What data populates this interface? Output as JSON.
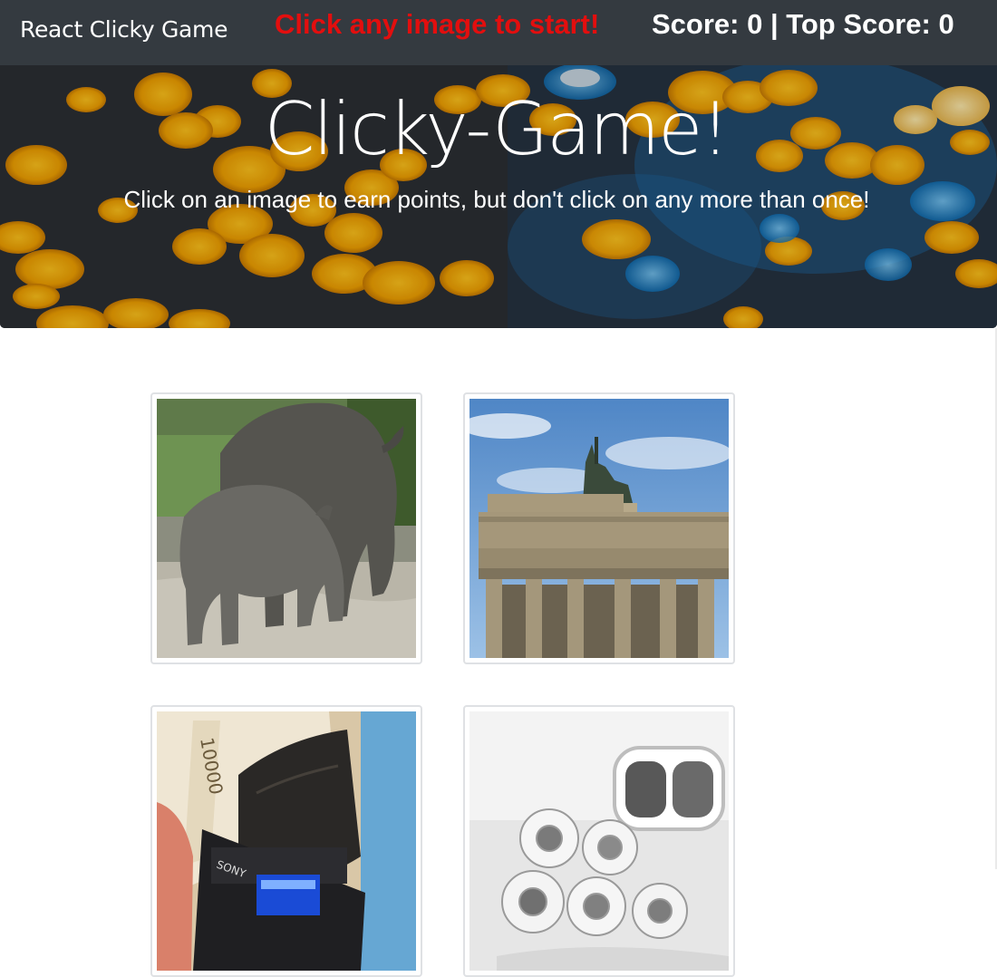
{
  "navbar": {
    "brand": "React Clicky Game",
    "status_message": "Click any image to start!",
    "status_color": "#e30e0e",
    "score_text": "Score: 0 | Top Score: 0"
  },
  "jumbotron": {
    "title": "Clicky-Game!",
    "subtitle": "Click on an image to earn points, but don't click on any more than once!"
  },
  "images": [
    {
      "subject": "rhinoceros"
    },
    {
      "subject": "brandenburg-gate"
    },
    {
      "subject": "wallet-and-camera"
    },
    {
      "subject": "sushi"
    }
  ],
  "colors": {
    "navbar_bg": "#343a40",
    "bokeh_gold": "#f2a100",
    "bokeh_blue": "#1e8fd6"
  }
}
